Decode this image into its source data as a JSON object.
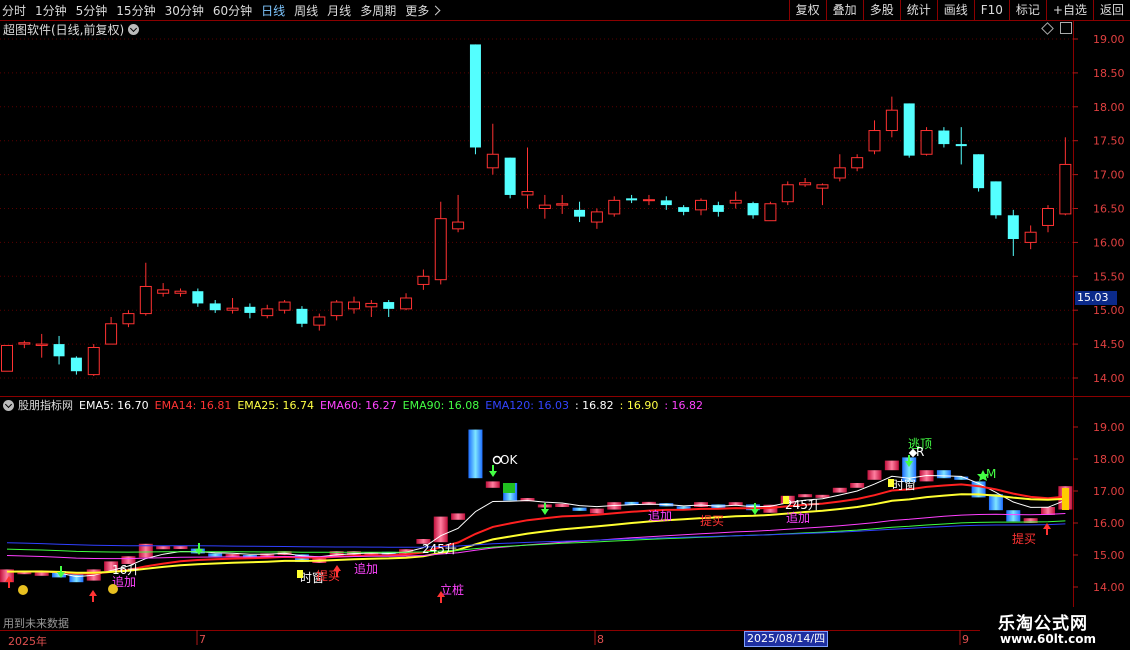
{
  "toolbar": {
    "periods": [
      "分时",
      "1分钟",
      "5分钟",
      "15分钟",
      "30分钟",
      "60分钟",
      "日线",
      "周线",
      "月线",
      "多周期",
      "更多"
    ],
    "active_period": "日线",
    "right_buttons": [
      "复权",
      "叠加",
      "多股",
      "统计",
      "画线",
      "F10",
      "标记",
      "+自选",
      "返回"
    ]
  },
  "main_chart": {
    "title": "超图软件(日线,前复权)",
    "price_axis": [
      "19.00",
      "18.50",
      "18.00",
      "17.50",
      "17.00",
      "16.50",
      "16.00",
      "15.50",
      "15.00",
      "14.50",
      "14.00"
    ],
    "current_price": "15.03"
  },
  "indicator": {
    "name": "股朋指标网",
    "values": [
      {
        "text": "EMA5: 16.70",
        "color": "#ffffff"
      },
      {
        "text": "EMA14: 16.81",
        "color": "#ff3333"
      },
      {
        "text": "EMA25: 16.74",
        "color": "#ffff44"
      },
      {
        "text": "EMA60: 16.27",
        "color": "#ff44ff"
      },
      {
        "text": "EMA90: 16.08",
        "color": "#44ff44"
      },
      {
        "text": "EMA120: 16.03",
        "color": "#3344ff"
      },
      {
        "text": ": 16.82",
        "color": "#ffffff"
      },
      {
        "text": ": 16.90",
        "color": "#ffff44"
      },
      {
        "text": ": 16.82",
        "color": "#ff44ff"
      }
    ],
    "price_axis": [
      "19.00",
      "18.00",
      "17.00",
      "16.00",
      "15.00",
      "14.00"
    ],
    "signals": [
      {
        "text": "16升",
        "color": "#ffffff"
      },
      {
        "text": "追加",
        "color": "#ff44ff"
      },
      {
        "text": "时窗",
        "color": "#ffffff"
      },
      {
        "text": "提买",
        "color": "#ff3333"
      },
      {
        "text": "追加",
        "color": "#ff44ff"
      },
      {
        "text": "245升",
        "color": "#ffffff"
      },
      {
        "text": "立桩",
        "color": "#ff44ff"
      },
      {
        "text": "OK",
        "color": "#ffffff"
      },
      {
        "text": "追加",
        "color": "#ff44ff"
      },
      {
        "text": "提买",
        "color": "#ff3333"
      },
      {
        "text": "245升",
        "color": "#ffffff"
      },
      {
        "text": "追加",
        "color": "#ff44ff"
      },
      {
        "text": "逃顶",
        "color": "#44ff44"
      },
      {
        "text": "R",
        "color": "#ffffff"
      },
      {
        "text": "时窗",
        "color": "#ffffff"
      },
      {
        "text": "M",
        "color": "#44ff44"
      },
      {
        "text": "提买",
        "color": "#ff3333"
      }
    ]
  },
  "status_text": "用到未来数据",
  "dates": {
    "year": "2025年",
    "m7": "7",
    "m8": "8",
    "m9": "9",
    "selected": "2025/08/14/四"
  },
  "watermark": {
    "line1": "乐淘公式网",
    "line2": "www.60lt.com"
  },
  "candles": [
    [
      14.1,
      14.48,
      14.1,
      14.48
    ],
    [
      14.5,
      14.52,
      14.44,
      14.55
    ],
    [
      14.48,
      14.5,
      14.3,
      14.65
    ],
    [
      14.5,
      14.32,
      14.2,
      14.62
    ],
    [
      14.3,
      14.1,
      14.05,
      14.32
    ],
    [
      14.05,
      14.45,
      14.03,
      14.5
    ],
    [
      14.5,
      14.8,
      14.5,
      14.9
    ],
    [
      14.8,
      14.95,
      14.75,
      15.0
    ],
    [
      14.95,
      15.35,
      14.92,
      15.7
    ],
    [
      15.25,
      15.3,
      15.2,
      15.4
    ],
    [
      15.25,
      15.28,
      15.2,
      15.32
    ],
    [
      15.28,
      15.1,
      15.05,
      15.32
    ],
    [
      15.1,
      15.0,
      14.96,
      15.15
    ],
    [
      15.0,
      15.03,
      14.95,
      15.18
    ],
    [
      15.05,
      14.96,
      14.88,
      15.1
    ],
    [
      14.92,
      15.02,
      14.88,
      15.08
    ],
    [
      15.0,
      15.12,
      14.95,
      15.15
    ],
    [
      15.02,
      14.8,
      14.75,
      15.06
    ],
    [
      14.78,
      14.9,
      14.7,
      14.95
    ],
    [
      14.92,
      15.12,
      14.85,
      15.15
    ],
    [
      15.02,
      15.12,
      14.95,
      15.2
    ],
    [
      15.05,
      15.1,
      14.9,
      15.15
    ],
    [
      15.12,
      15.02,
      14.9,
      15.15
    ],
    [
      15.02,
      15.18,
      15.0,
      15.25
    ],
    [
      15.38,
      15.5,
      15.3,
      15.6
    ],
    [
      15.45,
      16.35,
      15.38,
      16.6
    ],
    [
      16.2,
      16.3,
      16.15,
      16.7
    ],
    [
      18.92,
      17.4,
      17.3,
      18.92
    ],
    [
      17.1,
      17.3,
      17.0,
      17.75
    ],
    [
      17.25,
      16.7,
      16.65,
      17.25
    ],
    [
      16.7,
      16.75,
      16.5,
      17.4
    ],
    [
      16.5,
      16.55,
      16.35,
      16.7
    ],
    [
      16.55,
      16.57,
      16.42,
      16.7
    ],
    [
      16.48,
      16.38,
      16.3,
      16.6
    ],
    [
      16.3,
      16.45,
      16.2,
      16.5
    ],
    [
      16.42,
      16.62,
      16.38,
      16.68
    ],
    [
      16.65,
      16.62,
      16.58,
      16.7
    ],
    [
      16.62,
      16.63,
      16.55,
      16.7
    ],
    [
      16.62,
      16.55,
      16.48,
      16.68
    ],
    [
      16.52,
      16.45,
      16.4,
      16.55
    ],
    [
      16.48,
      16.62,
      16.4,
      16.65
    ],
    [
      16.55,
      16.45,
      16.38,
      16.6
    ],
    [
      16.58,
      16.62,
      16.5,
      16.75
    ],
    [
      16.58,
      16.4,
      16.35,
      16.6
    ],
    [
      16.32,
      16.57,
      16.32,
      16.6
    ],
    [
      16.6,
      16.85,
      16.55,
      16.9
    ],
    [
      16.85,
      16.88,
      16.82,
      16.95
    ],
    [
      16.8,
      16.85,
      16.55,
      16.87
    ],
    [
      16.95,
      17.1,
      16.9,
      17.3
    ],
    [
      17.1,
      17.25,
      17.05,
      17.3
    ],
    [
      17.35,
      17.65,
      17.3,
      17.8
    ],
    [
      17.65,
      17.95,
      17.55,
      18.15
    ],
    [
      18.05,
      17.28,
      17.25,
      18.05
    ],
    [
      17.3,
      17.65,
      17.28,
      17.7
    ],
    [
      17.65,
      17.45,
      17.4,
      17.7
    ],
    [
      17.45,
      17.42,
      17.15,
      17.7
    ],
    [
      17.3,
      16.8,
      16.75,
      17.3
    ],
    [
      16.9,
      16.4,
      16.35,
      16.9
    ],
    [
      16.4,
      16.05,
      15.8,
      16.48
    ],
    [
      16.0,
      16.15,
      15.9,
      16.25
    ],
    [
      16.25,
      16.5,
      16.15,
      16.55
    ],
    [
      16.42,
      17.15,
      16.4,
      17.55
    ]
  ],
  "ind_bars": [
    [
      14.15,
      14.55
    ],
    [
      14.4,
      14.5
    ],
    [
      14.35,
      14.5
    ],
    [
      14.3,
      14.5
    ],
    [
      14.15,
      14.4
    ],
    [
      14.2,
      14.55
    ],
    [
      14.5,
      14.8
    ],
    [
      14.72,
      14.96
    ],
    [
      14.92,
      15.35
    ],
    [
      15.18,
      15.28
    ],
    [
      15.2,
      15.28
    ],
    [
      15.05,
      15.2
    ],
    [
      14.98,
      15.05
    ],
    [
      14.98,
      15.03
    ],
    [
      14.9,
      15.0
    ],
    [
      14.95,
      15.05
    ],
    [
      15.0,
      15.12
    ],
    [
      14.78,
      15.02
    ],
    [
      14.75,
      14.92
    ],
    [
      14.95,
      15.12
    ],
    [
      15.0,
      15.12
    ],
    [
      14.98,
      15.08
    ],
    [
      15.0,
      15.1
    ],
    [
      15.02,
      15.18
    ],
    [
      15.35,
      15.5
    ],
    [
      15.4,
      16.2
    ],
    [
      16.1,
      16.3
    ],
    [
      17.4,
      18.92
    ],
    [
      17.1,
      17.3
    ],
    [
      16.7,
      17.25
    ],
    [
      16.68,
      16.78
    ],
    [
      16.5,
      16.58
    ],
    [
      16.5,
      16.6
    ],
    [
      16.38,
      16.48
    ],
    [
      16.3,
      16.45
    ],
    [
      16.42,
      16.65
    ],
    [
      16.6,
      16.66
    ],
    [
      16.58,
      16.66
    ],
    [
      16.52,
      16.62
    ],
    [
      16.45,
      16.52
    ],
    [
      16.5,
      16.65
    ],
    [
      16.45,
      16.58
    ],
    [
      16.55,
      16.65
    ],
    [
      16.4,
      16.58
    ],
    [
      16.32,
      16.57
    ],
    [
      16.6,
      16.85
    ],
    [
      16.82,
      16.9
    ],
    [
      16.8,
      16.88
    ],
    [
      16.95,
      17.1
    ],
    [
      17.1,
      17.25
    ],
    [
      17.35,
      17.65
    ],
    [
      17.65,
      17.95
    ],
    [
      17.28,
      18.05
    ],
    [
      17.3,
      17.65
    ],
    [
      17.4,
      17.65
    ],
    [
      17.35,
      17.45
    ],
    [
      16.8,
      17.3
    ],
    [
      16.4,
      16.9
    ],
    [
      16.05,
      16.4
    ],
    [
      16.0,
      16.15
    ],
    [
      16.25,
      16.5
    ],
    [
      16.42,
      17.15
    ]
  ]
}
